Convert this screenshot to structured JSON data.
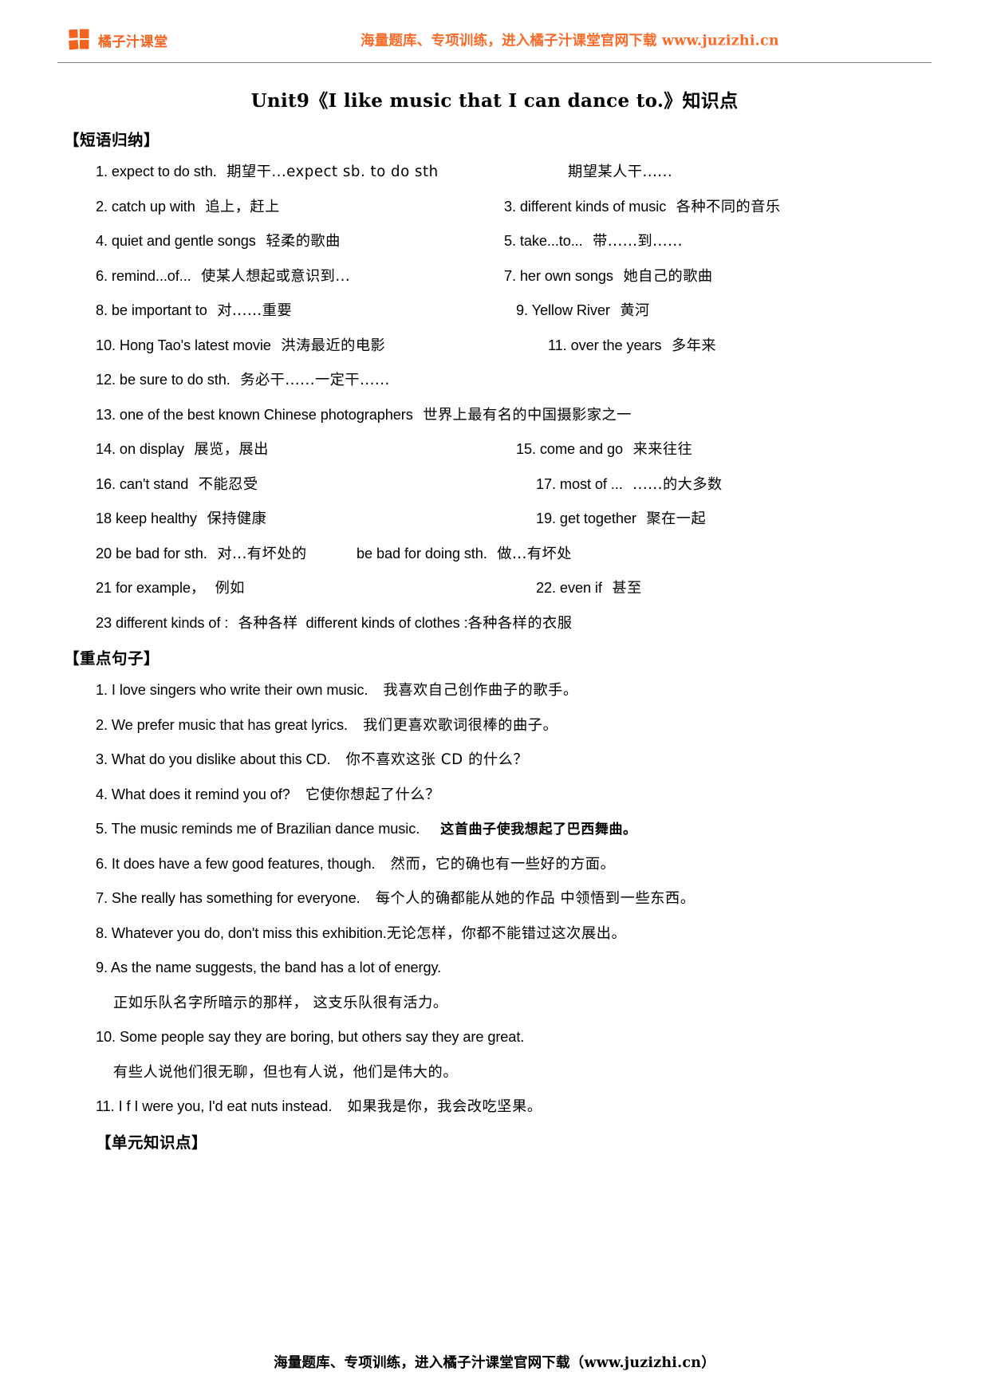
{
  "header": {
    "brand_name": "橘子汁课堂",
    "logo_icon": "orange-juice-squares-logo",
    "promo_text": "海量题库、专项训练，进入橘子汁课堂官网下载 www.juzizhi.cn",
    "brand_color": "#F4621F",
    "promo_color": "#FA6A28"
  },
  "title": {
    "unit": "Unit9",
    "open_bracket": "《",
    "english": "I like music that I can dance to.",
    "close_bracket": "》",
    "suffix": "知识点",
    "full": "Unit9《I like music that I can dance to.》知识点"
  },
  "sections": {
    "phrases_head": "【短语归纳】",
    "sentences_head": "【重点句子】",
    "unit_points_head": "【单元知识点】"
  },
  "phrases": [
    {
      "left": "1. expect to do sth.",
      "left_cn": "期望干...expect sb. to do sth",
      "right": "",
      "right_cn": "期望某人干......",
      "right_offset": "p640",
      "single": true
    },
    {
      "left": "2. catch up with",
      "left_cn": "追上，赶上",
      "right": "3. different kinds of music",
      "right_cn": "各种不同的音乐",
      "right_offset": "p560"
    },
    {
      "left": "4. quiet and gentle songs",
      "left_cn": "轻柔的歌曲",
      "right": "5.    take...to...",
      "right_cn": "带......到......",
      "right_offset": "p560"
    },
    {
      "left": "6. remind...of...",
      "left_cn": "使某人想起或意识到...",
      "right": "7. her own songs",
      "right_cn": "她自己的歌曲",
      "right_offset": "p560"
    },
    {
      "left": "8. be important to",
      "left_cn": "对......重要",
      "right": "9. Yellow River",
      "right_cn": "黄河",
      "right_offset": "p575"
    },
    {
      "left": "10. Hong Tao's latest movie",
      "left_cn": "洪涛最近的电影",
      "right": "11.    over the years",
      "right_cn": "多年来",
      "right_offset": "p615"
    },
    {
      "left": "12. be sure to do sth.",
      "left_cn": "务必干......一定干......",
      "right": "",
      "right_cn": "",
      "single": true
    },
    {
      "left": "13. one of the best known Chinese photographers",
      "left_cn": "世界上最有名的中国摄影家之一",
      "right": "",
      "right_cn": "",
      "single": true
    },
    {
      "left": "14. on display",
      "left_cn": "展览，展出",
      "right": "15. come and go",
      "right_cn": "来来往往",
      "right_offset": "p575"
    },
    {
      "left": "16. can't stand",
      "left_cn": "不能忍受",
      "right": "17. most of ...",
      "right_cn": "......的大多数",
      "right_offset": "p600"
    },
    {
      "left": "18 keep healthy",
      "left_cn": "保持健康",
      "right": "19. get together",
      "right_cn": "聚在一起",
      "right_offset": "p600"
    },
    {
      "left": "20 be bad for sth.",
      "left_cn": "对...有坏处的",
      "right": "be bad for doing sth.",
      "right_cn": "做...有坏处",
      "right_offset": "p375"
    },
    {
      "left": "21 for example，",
      "left_cn": "例如",
      "right": "22. even if",
      "right_cn": "甚至",
      "right_offset": "p600"
    },
    {
      "left": "23 different kinds of :",
      "left_cn": "各种各样",
      "right": "different kinds of clothes :",
      "right_cn": "各种各样的衣服",
      "inline": true
    }
  ],
  "sentences": [
    {
      "num": "1.",
      "en": "I love singers who write their own music.",
      "cn": "我喜欢自己创作曲子的歌手。",
      "bold": false
    },
    {
      "num": "2.",
      "en": "We prefer music that has great lyrics.",
      "cn": "我们更喜欢歌词很棒的曲子。",
      "bold": false
    },
    {
      "num": "3.",
      "en": "What do you dislike about this CD.",
      "cn": "你不喜欢这张 CD 的什么？",
      "bold": false
    },
    {
      "num": "4.",
      "en": "What does it remind you of?",
      "cn": "它使你想起了什么？",
      "bold": false
    },
    {
      "num": "5.",
      "en": "The music reminds me of Brazilian dance music.",
      "cn": "这首曲子使我想起了巴西舞曲。",
      "bold": true
    },
    {
      "num": "6.",
      "en": "It does have a few good features, though.",
      "cn": "然而，它的确也有一些好的方面。",
      "bold": false
    },
    {
      "num": "7.",
      "en": "She really has something for everyone.",
      "cn": "每个人的确都能从她的作品 中领悟到一些东西。",
      "bold": false
    },
    {
      "num": "8.",
      "en": "Whatever you do, don't miss this exhibition.",
      "cn": "无论怎样，你都不能错过这次展出。",
      "bold": false,
      "tight": true
    },
    {
      "num": "9.",
      "en": "As the name suggests, the band has a lot of energy.",
      "cn": "",
      "bold": false
    },
    {
      "num": "",
      "en": "",
      "cn": "正如乐队名字所暗示的那样， 这支乐队很有活力。",
      "bold": false,
      "continuation": true
    },
    {
      "num": "10.",
      "en": "Some people say they are boring, but others say they are great.",
      "cn": "",
      "bold": false
    },
    {
      "num": "",
      "en": "",
      "cn": "有些人说他们很无聊，但也有人说，他们是伟大的。",
      "bold": false,
      "continuation": true
    },
    {
      "num": "11.",
      "en": "I f I were you, I'd eat nuts instead.",
      "cn": "如果我是你，我会改吃坚果。",
      "bold": false
    }
  ],
  "footer": {
    "text": "海量题库、专项训练，进入橘子汁课堂官网下载（www.juzizhi.cn）"
  }
}
